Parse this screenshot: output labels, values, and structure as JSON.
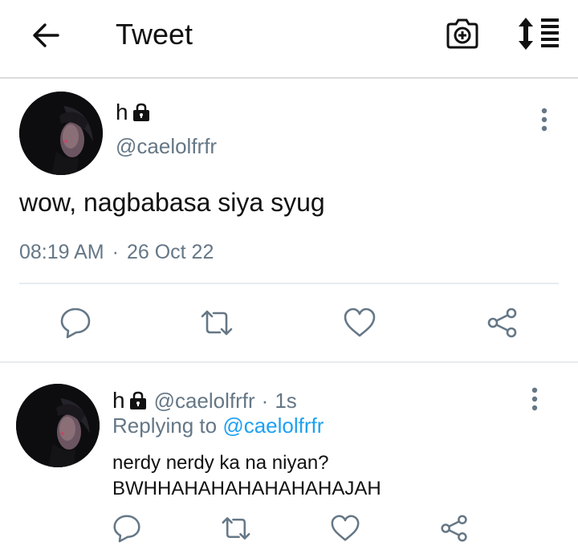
{
  "header": {
    "title": "Tweet",
    "icons": [
      "back-arrow-icon",
      "camera-add-icon",
      "sort-icon"
    ]
  },
  "tweet": {
    "author_name": "h",
    "author_handle": "@caelolfrfr",
    "locked": true,
    "text": "wow, nagbabasa siya syug",
    "time": "08:19 AM",
    "separator": "·",
    "date": "26 Oct 22",
    "actions": [
      "reply-icon",
      "retweet-icon",
      "like-icon",
      "share-icon"
    ]
  },
  "reply": {
    "author_name": "h",
    "author_handle": "@caelolfrfr",
    "separator": "·",
    "time": "1s",
    "replying_prefix": "Replying to",
    "replying_to": "@caelolfrfr",
    "text": "nerdy nerdy ka na niyan?\nBWHHAHAHAHAHAHAHAJAH",
    "actions": [
      "reply-icon",
      "retweet-icon",
      "like-icon",
      "share-icon"
    ]
  },
  "colors": {
    "secondary_text": "#657786",
    "link": "#1da1f2",
    "divider": "#e6ecf0",
    "icon": "#657786"
  }
}
